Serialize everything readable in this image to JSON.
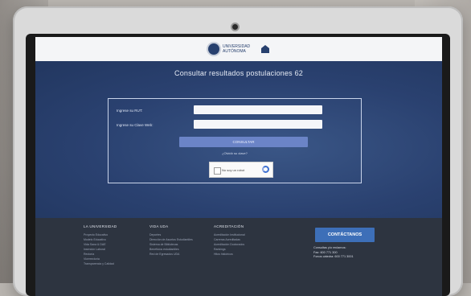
{
  "header": {
    "logo_text": "UNIVERSIDAD AUTÓNOMA"
  },
  "page": {
    "title": "Consultar resultados postulaciones 62"
  },
  "form": {
    "rut_label": "Ingrese su RUT:",
    "rut_placeholder": "",
    "password_label": "Ingrese su Clave Web:",
    "password_placeholder": "",
    "submit_label": "CONSULTAR",
    "link_text": "¿Olvidó su clave?",
    "captcha_label": "No soy un robot"
  },
  "footer": {
    "col1": {
      "heading": "LA UNIVERSIDAD",
      "items": [
        "Proyecto Educativo",
        "Modelo Educativo",
        "Vida Sana & DAE",
        "Inserción Laboral",
        "Rectoría",
        "Vicerrectoría",
        "Transparencia y Calidad"
      ]
    },
    "col2": {
      "heading": "VIDA UDA",
      "items": [
        "Deportes",
        "Dirección de Asuntos Estudiantiles",
        "Sistema de Bibliotecas",
        "Beneficios estudiantiles",
        "Red de Egresados UDA"
      ]
    },
    "col3": {
      "heading": "ACREDITACIÓN",
      "items": [
        "Acreditación Institucional",
        "Carreras Acreditadas",
        "Acreditación Doctorados",
        "Rankings",
        "Hitos históricos"
      ]
    },
    "contact_button": "CONTÁCTANOS",
    "contact_lines": [
      "Consultas y/o reclamos:",
      "Fax: 600 771 300",
      "Fonos cátedra: 600 771 3001"
    ]
  },
  "colors": {
    "screen_bg": "#2b4068",
    "accent_button": "#6b84c7",
    "contact_button": "#3d6fb8",
    "footer_bg": "#2d3440"
  }
}
